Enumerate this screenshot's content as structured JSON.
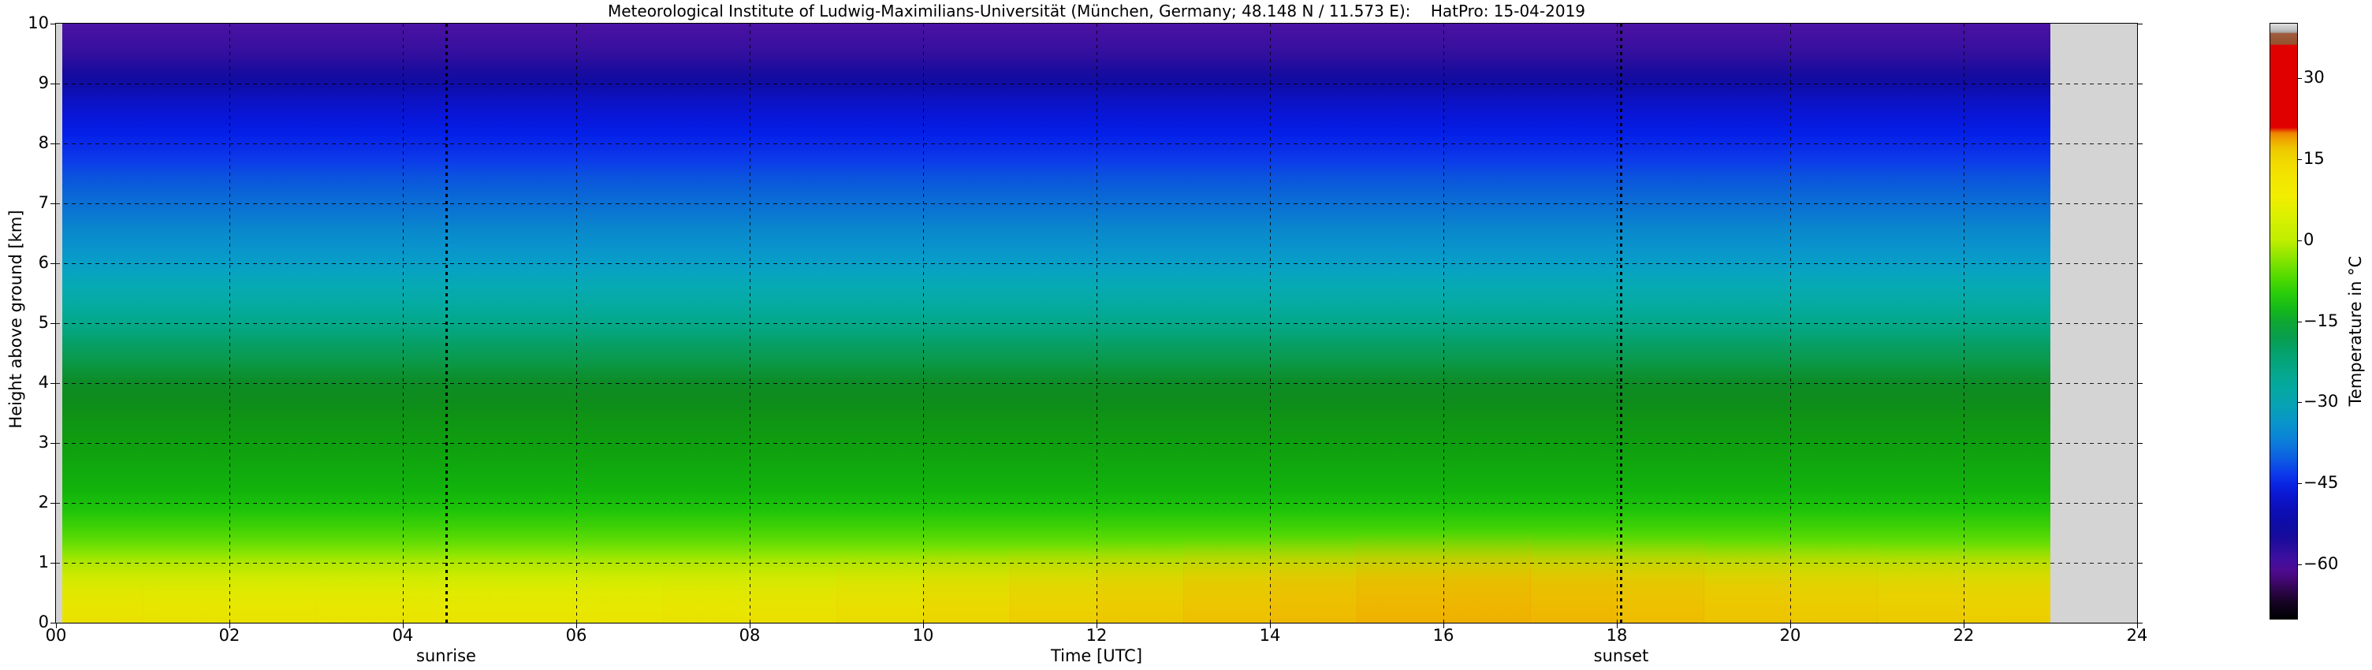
{
  "title": "Meteorological Institute of Ludwig-Maximilians-Universität (München, Germany; 48.148 N / 11.573 E):    HatPro: 15-04-2019",
  "axes": {
    "x": {
      "label": "Time [UTC]",
      "range_hours": [
        0,
        24
      ],
      "ticks": [
        {
          "h": 0,
          "label": "00"
        },
        {
          "h": 2,
          "label": "02"
        },
        {
          "h": 4,
          "label": "04"
        },
        {
          "h": 6,
          "label": "06"
        },
        {
          "h": 8,
          "label": "08"
        },
        {
          "h": 10,
          "label": "10"
        },
        {
          "h": 12,
          "label": "12"
        },
        {
          "h": 14,
          "label": "14"
        },
        {
          "h": 16,
          "label": "16"
        },
        {
          "h": 18,
          "label": "18"
        },
        {
          "h": 20,
          "label": "20"
        },
        {
          "h": 22,
          "label": "22"
        },
        {
          "h": 24,
          "label": "24"
        }
      ]
    },
    "y": {
      "label": "Height above ground [km]",
      "range_km": [
        0,
        10
      ],
      "ticks": [
        {
          "km": 0,
          "label": "0"
        },
        {
          "km": 1,
          "label": "1"
        },
        {
          "km": 2,
          "label": "2"
        },
        {
          "km": 3,
          "label": "3"
        },
        {
          "km": 4,
          "label": "4"
        },
        {
          "km": 5,
          "label": "5"
        },
        {
          "km": 6,
          "label": "6"
        },
        {
          "km": 7,
          "label": "7"
        },
        {
          "km": 8,
          "label": "8"
        },
        {
          "km": 9,
          "label": "9"
        },
        {
          "km": 10,
          "label": "10"
        }
      ]
    }
  },
  "events": [
    {
      "name": "sunrise",
      "label": "sunrise",
      "hour": 4.5
    },
    {
      "name": "sunset",
      "label": "sunset",
      "hour": 18.05
    }
  ],
  "colorbar": {
    "label": "Temperature in °C",
    "range_c": [
      -70,
      40
    ],
    "ticks": [
      {
        "v": 30,
        "label": "30"
      },
      {
        "v": 15,
        "label": "15"
      },
      {
        "v": 0,
        "label": "0"
      },
      {
        "v": -15,
        "label": "−15"
      },
      {
        "v": -30,
        "label": "−30"
      },
      {
        "v": -45,
        "label": "−45"
      },
      {
        "v": -60,
        "label": "−60"
      }
    ],
    "stops": [
      {
        "v": 40,
        "c": "#dedede"
      },
      {
        "v": 39,
        "c": "#c4c4c4"
      },
      {
        "v": 38.4,
        "c": "#aaaaaa"
      },
      {
        "v": 38.2,
        "c": "#a05c40"
      },
      {
        "v": 36.2,
        "c": "#94522e"
      },
      {
        "v": 36,
        "c": "#e00000"
      },
      {
        "v": 20.8,
        "c": "#e00000"
      },
      {
        "v": 19.8,
        "c": "#ee8200"
      },
      {
        "v": 18.6,
        "c": "#f0a400"
      },
      {
        "v": 17,
        "c": "#eec600"
      },
      {
        "v": 15,
        "c": "#f0d600"
      },
      {
        "v": 12,
        "c": "#f2e400"
      },
      {
        "v": 8,
        "c": "#f2ee00"
      },
      {
        "v": 4,
        "c": "#d8f000"
      },
      {
        "v": 0,
        "c": "#c0ee00"
      },
      {
        "v": -3,
        "c": "#90e600"
      },
      {
        "v": -7,
        "c": "#50da00"
      },
      {
        "v": -10,
        "c": "#28cc0a"
      },
      {
        "v": -13,
        "c": "#14b81c"
      },
      {
        "v": -15,
        "c": "#0ea832"
      },
      {
        "v": -18,
        "c": "#089e4e"
      },
      {
        "v": -21,
        "c": "#05a26e"
      },
      {
        "v": -25,
        "c": "#04a890"
      },
      {
        "v": -28,
        "c": "#05a8a4"
      },
      {
        "v": -31,
        "c": "#07a0b6"
      },
      {
        "v": -34,
        "c": "#0894cc"
      },
      {
        "v": -37,
        "c": "#0b80d8"
      },
      {
        "v": -40,
        "c": "#0c62e0"
      },
      {
        "v": -43,
        "c": "#0c3cea"
      },
      {
        "v": -45,
        "c": "#0a26e4"
      },
      {
        "v": -47,
        "c": "#0b18d2"
      },
      {
        "v": -50,
        "c": "#0d0eb6"
      },
      {
        "v": -53,
        "c": "#0e0ca2"
      },
      {
        "v": -55,
        "c": "#180b9c"
      },
      {
        "v": -57,
        "c": "#2c0e9e"
      },
      {
        "v": -59,
        "c": "#400fa0"
      },
      {
        "v": -61,
        "c": "#4e0c92"
      },
      {
        "v": -62.5,
        "c": "#460878"
      },
      {
        "v": -64,
        "c": "#36065a"
      },
      {
        "v": -65.5,
        "c": "#26053e"
      },
      {
        "v": -67,
        "c": "#160324"
      },
      {
        "v": -68.5,
        "c": "#0a0212"
      },
      {
        "v": -70,
        "c": "#000000"
      }
    ]
  },
  "chart_data": {
    "type": "heatmap",
    "title": "Meteorological Institute of Ludwig-Maximilians-Universität (München, Germany; 48.148 N / 11.573 E):    HatPro: 15-04-2019",
    "xlabel": "Time [UTC]",
    "ylabel": "Height above ground [km]",
    "colorbar_label": "Temperature in °C",
    "x_range_hours": [
      0,
      24
    ],
    "y_range_km": [
      0,
      10
    ],
    "temperature_range_c": [
      -70,
      40
    ],
    "data_time_span_hours": [
      0.07,
      23.0
    ],
    "no_data_color": "#d4d4d4",
    "grid": "dashed black, every 2 h vertical and 1 km horizontal",
    "events": [
      {
        "name": "sunrise",
        "hour": 4.5
      },
      {
        "name": "sunset",
        "hour": 18.05
      }
    ],
    "temperature_profile": [
      {
        "height_km": 0.0,
        "temp_c": 8,
        "color": "#e8e800"
      },
      {
        "height_km": 0.25,
        "temp_c": 7,
        "color": "#e6ec00"
      },
      {
        "height_km": 0.5,
        "temp_c": 6,
        "color": "#deee00"
      },
      {
        "height_km": 0.75,
        "temp_c": 5,
        "color": "#cdee00"
      },
      {
        "height_km": 1.0,
        "temp_c": 3,
        "color": "#aee800"
      },
      {
        "height_km": 1.15,
        "temp_c": 1,
        "color": "#8ce502"
      },
      {
        "height_km": 1.35,
        "temp_c": -1,
        "color": "#62dd04"
      },
      {
        "height_km": 1.6,
        "temp_c": -3,
        "color": "#3ed106"
      },
      {
        "height_km": 1.9,
        "temp_c": -5,
        "color": "#1dc309"
      },
      {
        "height_km": 2.2,
        "temp_c": -7,
        "color": "#12b40c"
      },
      {
        "height_km": 2.6,
        "temp_c": -9,
        "color": "#10a80e"
      },
      {
        "height_km": 3.0,
        "temp_c": -11,
        "color": "#0f9e10"
      },
      {
        "height_km": 3.4,
        "temp_c": -13,
        "color": "#0f9414"
      },
      {
        "height_km": 3.7,
        "temp_c": -15,
        "color": "#0e8c1c"
      },
      {
        "height_km": 4.0,
        "temp_c": -16,
        "color": "#0d8c26"
      },
      {
        "height_km": 4.2,
        "temp_c": -17,
        "color": "#0c9338"
      },
      {
        "height_km": 4.4,
        "temp_c": -19,
        "color": "#0a9a4e"
      },
      {
        "height_km": 4.6,
        "temp_c": -20,
        "color": "#079e60"
      },
      {
        "height_km": 4.8,
        "temp_c": -22,
        "color": "#05a376"
      },
      {
        "height_km": 5.0,
        "temp_c": -24,
        "color": "#04a88a"
      },
      {
        "height_km": 5.3,
        "temp_c": -26,
        "color": "#05aaa0"
      },
      {
        "height_km": 5.6,
        "temp_c": -28,
        "color": "#06aab2"
      },
      {
        "height_km": 5.95,
        "temp_c": -30,
        "color": "#08a0c6"
      },
      {
        "height_km": 6.25,
        "temp_c": -32,
        "color": "#0994cc"
      },
      {
        "height_km": 6.55,
        "temp_c": -34,
        "color": "#0988cc"
      },
      {
        "height_km": 6.85,
        "temp_c": -36,
        "color": "#0a76d2"
      },
      {
        "height_km": 7.15,
        "temp_c": -38,
        "color": "#0a66d6"
      },
      {
        "height_km": 7.45,
        "temp_c": -41,
        "color": "#0b52de"
      },
      {
        "height_km": 7.7,
        "temp_c": -43,
        "color": "#0c3cea"
      },
      {
        "height_km": 7.95,
        "temp_c": -45,
        "color": "#0a2ce8"
      },
      {
        "height_km": 8.15,
        "temp_c": -47,
        "color": "#0420e8"
      },
      {
        "height_km": 8.45,
        "temp_c": -50,
        "color": "#0816d8"
      },
      {
        "height_km": 8.75,
        "temp_c": -52,
        "color": "#0c12c0"
      },
      {
        "height_km": 9.0,
        "temp_c": -54,
        "color": "#100ca4"
      },
      {
        "height_km": 9.2,
        "temp_c": -56,
        "color": "#190c9e"
      },
      {
        "height_km": 9.45,
        "temp_c": -58,
        "color": "#2f0f9e"
      },
      {
        "height_km": 9.7,
        "temp_c": -60,
        "color": "#3e10a0"
      },
      {
        "height_km": 10.0,
        "temp_c": -62,
        "color": "#4a12a2"
      }
    ],
    "surface_diurnal": [
      {
        "hour": 0,
        "temp_c": 8.5
      },
      {
        "hour": 3,
        "temp_c": 8
      },
      {
        "hour": 6,
        "temp_c": 7.5
      },
      {
        "hour": 9,
        "temp_c": 9
      },
      {
        "hour": 12,
        "temp_c": 12
      },
      {
        "hour": 14,
        "temp_c": 13.5
      },
      {
        "hour": 16,
        "temp_c": 15
      },
      {
        "hour": 18,
        "temp_c": 14
      },
      {
        "hour": 20,
        "temp_c": 12.5
      },
      {
        "hour": 23,
        "temp_c": 11.5
      }
    ]
  }
}
